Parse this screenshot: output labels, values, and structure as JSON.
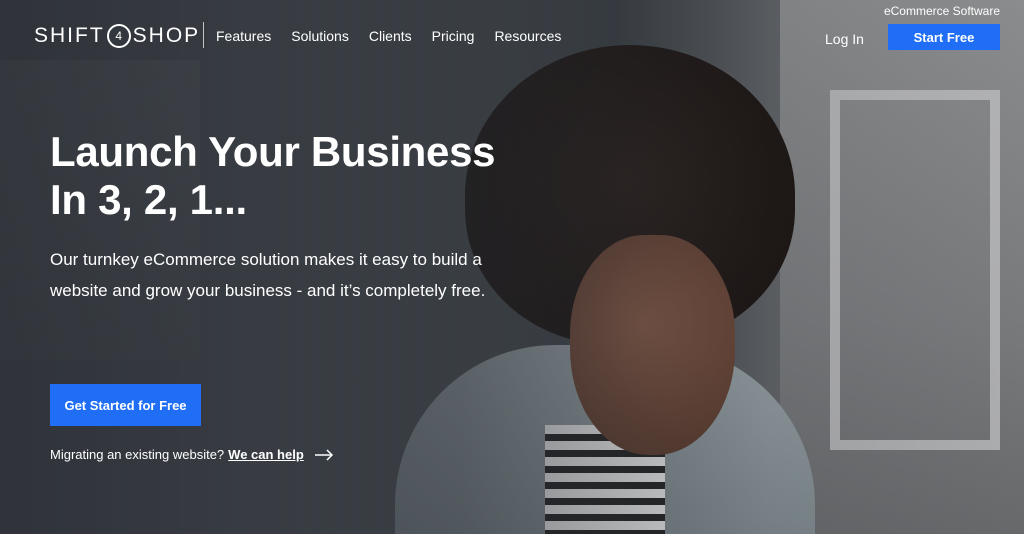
{
  "brand": {
    "logo_text_left": "SHIFT",
    "logo_mark": "4",
    "logo_text_right": "SHOP",
    "tagline": "eCommerce Software"
  },
  "nav": {
    "items": [
      "Features",
      "Solutions",
      "Clients",
      "Pricing",
      "Resources"
    ]
  },
  "header": {
    "login_label": "Log In",
    "start_label": "Start Free"
  },
  "hero": {
    "title_line1": "Launch Your Business",
    "title_line2": "In 3, 2, 1...",
    "lead": "Our turnkey eCommerce solution makes it easy to build a website and grow your business - and it’s completely free.",
    "cta_label": "Get Started for Free",
    "migrate_text": "Migrating an existing website?",
    "migrate_link": "We can help",
    "arrow_icon": "arrow-right-icon"
  },
  "colors": {
    "accent": "#1f6ef5",
    "text": "#ffffff"
  }
}
